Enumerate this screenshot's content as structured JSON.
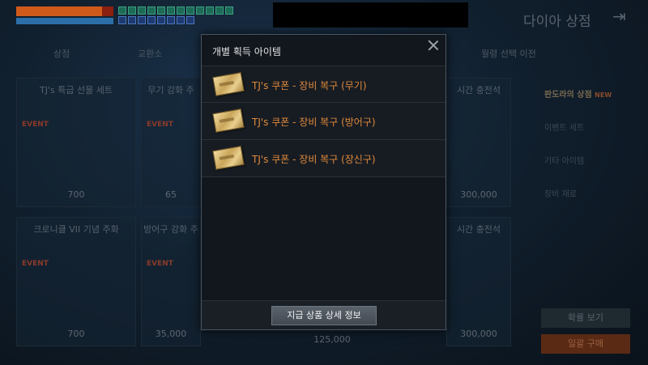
{
  "shop": {
    "title": "다이아 상점",
    "exit_icon": "exit-icon"
  },
  "tabs": [
    "상점",
    "교환소",
    "월령 선택 이전"
  ],
  "cards": [
    {
      "title": "TJ's 특급 선물 세트",
      "event": "EVENT",
      "price": "700"
    },
    {
      "title": "무기 강화 주",
      "event": "EVENT",
      "price": "65"
    },
    {
      "title": "시간 충전석",
      "event": "",
      "price": "300,000"
    },
    {
      "title": "크로니클 VII 기념 주화",
      "event": "EVENT",
      "price": "700"
    },
    {
      "title": "방어구 강화 주",
      "event": "EVENT",
      "price": "35,000"
    },
    {
      "title": "",
      "event": "",
      "price": "125,000"
    },
    {
      "title": "시간 충전석",
      "event": "",
      "price": "300,000"
    }
  ],
  "side_menu": {
    "items": [
      "판도라의 상점",
      "이벤트 세트",
      "기타 아이템",
      "장비 재료"
    ],
    "new_badge": "NEW"
  },
  "side_buttons": {
    "view": "확률 보기",
    "buy": "일괄 구매"
  },
  "modal": {
    "title": "개별 획득 아이템",
    "items": [
      {
        "label": "TJ's 쿠폰 - 장비 복구 (무기)",
        "icon": "coupon-icon"
      },
      {
        "label": "TJ's 쿠폰 - 장비 복구 (방어구)",
        "icon": "coupon-icon"
      },
      {
        "label": "TJ's 쿠폰 - 장비 복구 (장신구)",
        "icon": "coupon-icon"
      }
    ],
    "detail_button": "지급 상품 상세 정보"
  },
  "hud": {
    "hp_fraction": 0.88
  },
  "colors": {
    "accent": "#e0893a",
    "panel": "#12171d"
  }
}
